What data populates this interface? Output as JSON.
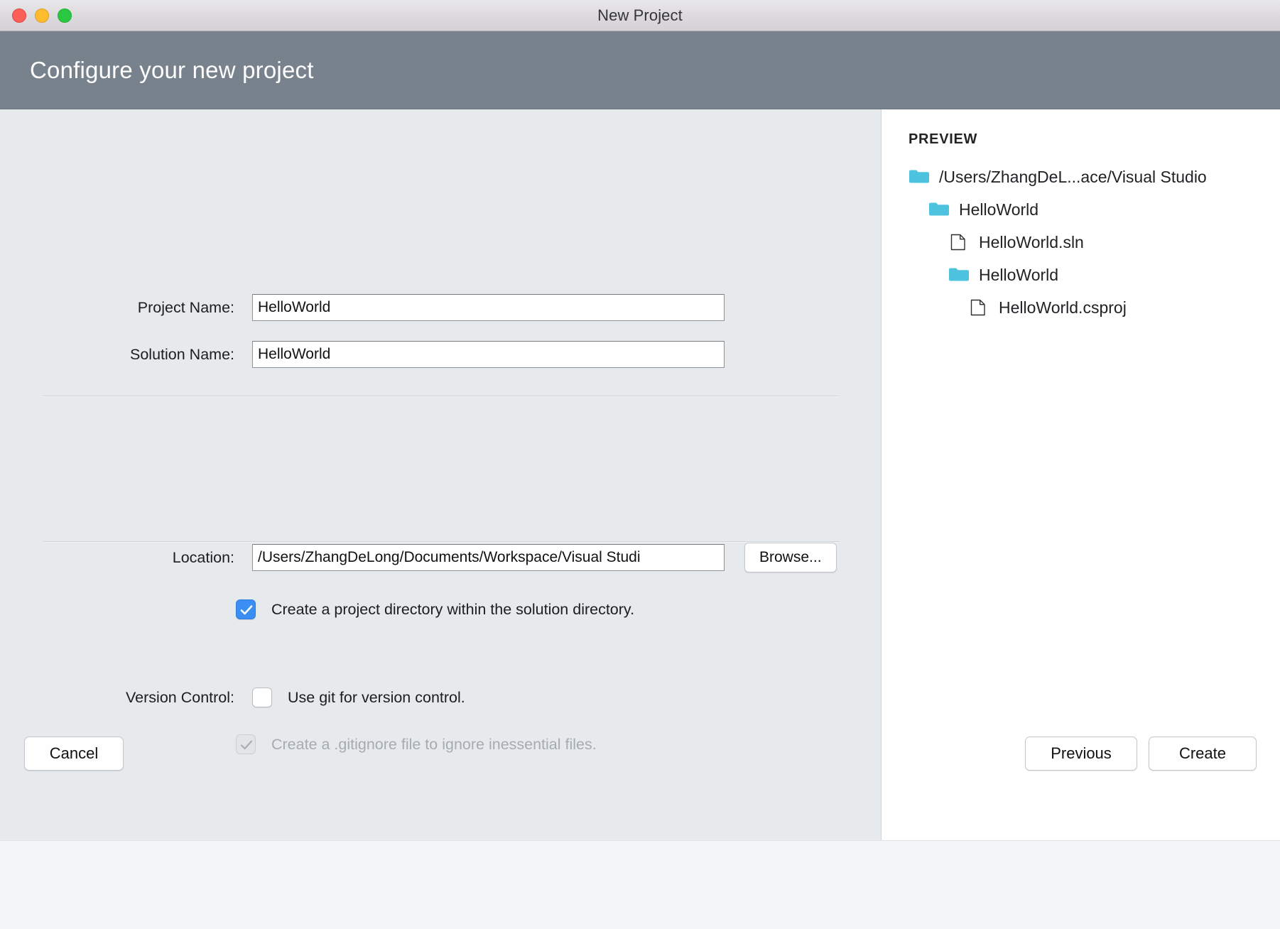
{
  "window": {
    "title": "New Project",
    "traffic_lights": [
      {
        "name": "close",
        "color": "#fc5f57"
      },
      {
        "name": "minimize",
        "color": "#febc2e"
      },
      {
        "name": "maximize",
        "color": "#29c840"
      }
    ]
  },
  "header": {
    "title": "Configure your new project",
    "background": "#78828c"
  },
  "form": {
    "project_name": {
      "label": "Project Name:",
      "value": "HelloWorld",
      "placeholder": ""
    },
    "solution_name": {
      "label": "Solution Name:",
      "value": "HelloWorld",
      "placeholder": ""
    },
    "location": {
      "label": "Location:",
      "value": "/Users/ZhangDeLong/Documents/Workspace/Visual Studi",
      "placeholder": "",
      "browse_label": "Browse..."
    },
    "project_directory": {
      "label": "Create a project directory within the solution directory.",
      "checked": true,
      "enabled": true
    },
    "version_control": {
      "label": "Version Control:",
      "use_git": {
        "label": "Use git for version control.",
        "checked": false,
        "enabled": true
      },
      "gitignore": {
        "label": "Create a .gitignore file to ignore inessential files.",
        "checked": true,
        "enabled": false
      }
    }
  },
  "preview": {
    "title": "PREVIEW",
    "folder_color": "#4ec3e0",
    "tree": [
      {
        "type": "folder",
        "label": "/Users/ZhangDeL...ace/Visual Studio",
        "depth": 0
      },
      {
        "type": "folder",
        "label": "HelloWorld",
        "depth": 1
      },
      {
        "type": "file",
        "label": "HelloWorld.sln",
        "depth": 2
      },
      {
        "type": "folder",
        "label": "HelloWorld",
        "depth": 2
      },
      {
        "type": "file",
        "label": "HelloWorld.csproj",
        "depth": 3
      }
    ]
  },
  "footer": {
    "cancel_label": "Cancel",
    "previous_label": "Previous",
    "create_label": "Create"
  }
}
